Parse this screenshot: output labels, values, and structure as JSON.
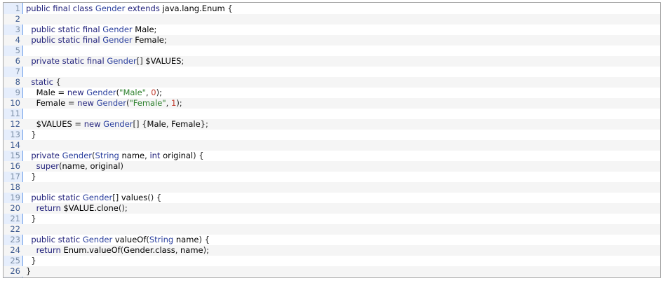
{
  "code": {
    "lines": [
      {
        "n": "1",
        "text": "public final class Gender extends java.lang.Enum {"
      },
      {
        "n": "2",
        "text": ""
      },
      {
        "n": "3",
        "text": "  public static final Gender Male;"
      },
      {
        "n": "4",
        "text": "  public static final Gender Female;"
      },
      {
        "n": "5",
        "text": ""
      },
      {
        "n": "6",
        "text": "  private static final Gender[] $VALUES;"
      },
      {
        "n": "7",
        "text": ""
      },
      {
        "n": "8",
        "text": "  static {"
      },
      {
        "n": "9",
        "text": "    Male = new Gender(\"Male\", 0);"
      },
      {
        "n": "10",
        "text": "    Female = new Gender(\"Female\", 1);"
      },
      {
        "n": "11",
        "text": ""
      },
      {
        "n": "12",
        "text": "    $VALUES = new Gender[] {Male, Female};"
      },
      {
        "n": "13",
        "text": "  }"
      },
      {
        "n": "14",
        "text": ""
      },
      {
        "n": "15",
        "text": "  private Gender(String name, int original) {"
      },
      {
        "n": "16",
        "text": "    super(name, original)"
      },
      {
        "n": "17",
        "text": "  }"
      },
      {
        "n": "18",
        "text": ""
      },
      {
        "n": "19",
        "text": "  public static Gender[] values() {"
      },
      {
        "n": "20",
        "text": "    return $VALUE.clone();"
      },
      {
        "n": "21",
        "text": "  }"
      },
      {
        "n": "22",
        "text": ""
      },
      {
        "n": "23",
        "text": "  public static Gender valueOf(String name) {"
      },
      {
        "n": "24",
        "text": "    return Enum.valueOf(Gender.class, name);"
      },
      {
        "n": "25",
        "text": "  }"
      },
      {
        "n": "26",
        "text": "}"
      }
    ]
  }
}
